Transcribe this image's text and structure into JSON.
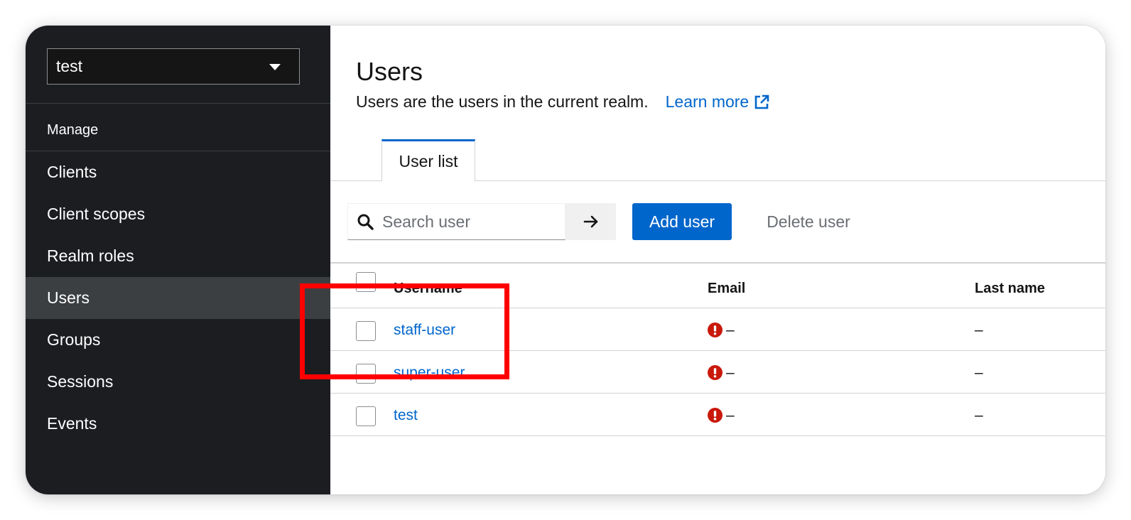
{
  "sidebar": {
    "realm_selector": "test",
    "section_label": "Manage",
    "items": [
      {
        "label": "Clients",
        "active": false
      },
      {
        "label": "Client scopes",
        "active": false
      },
      {
        "label": "Realm roles",
        "active": false
      },
      {
        "label": "Users",
        "active": true
      },
      {
        "label": "Groups",
        "active": false
      },
      {
        "label": "Sessions",
        "active": false
      },
      {
        "label": "Events",
        "active": false
      }
    ]
  },
  "main": {
    "title": "Users",
    "description": "Users are the users in the current realm.",
    "learn_more": "Learn more",
    "tabs": [
      {
        "label": "User list",
        "active": true
      }
    ],
    "toolbar": {
      "search_placeholder": "Search user",
      "search_value": "",
      "add_button": "Add user",
      "delete_button": "Delete user"
    },
    "table": {
      "columns": [
        "Username",
        "Email",
        "Last name"
      ],
      "rows": [
        {
          "username": "staff-user",
          "email": "–",
          "last_name": "–"
        },
        {
          "username": "super-user",
          "email": "–",
          "last_name": "–"
        },
        {
          "username": "test",
          "email": "–",
          "last_name": "–"
        }
      ]
    }
  },
  "colors": {
    "sidebar_bg": "#1b1d21",
    "active_item_bg": "#3c3f42",
    "link_blue": "#0066cc",
    "primary_button": "#0066cc",
    "warning_red": "#c9190b",
    "highlight_box": "#ff0000"
  },
  "icons": {
    "search": "search-icon",
    "submit": "arrow-right-icon",
    "external": "external-link-icon",
    "email_status": "exclamation-circle-icon",
    "dropdown": "caret-down-icon"
  }
}
